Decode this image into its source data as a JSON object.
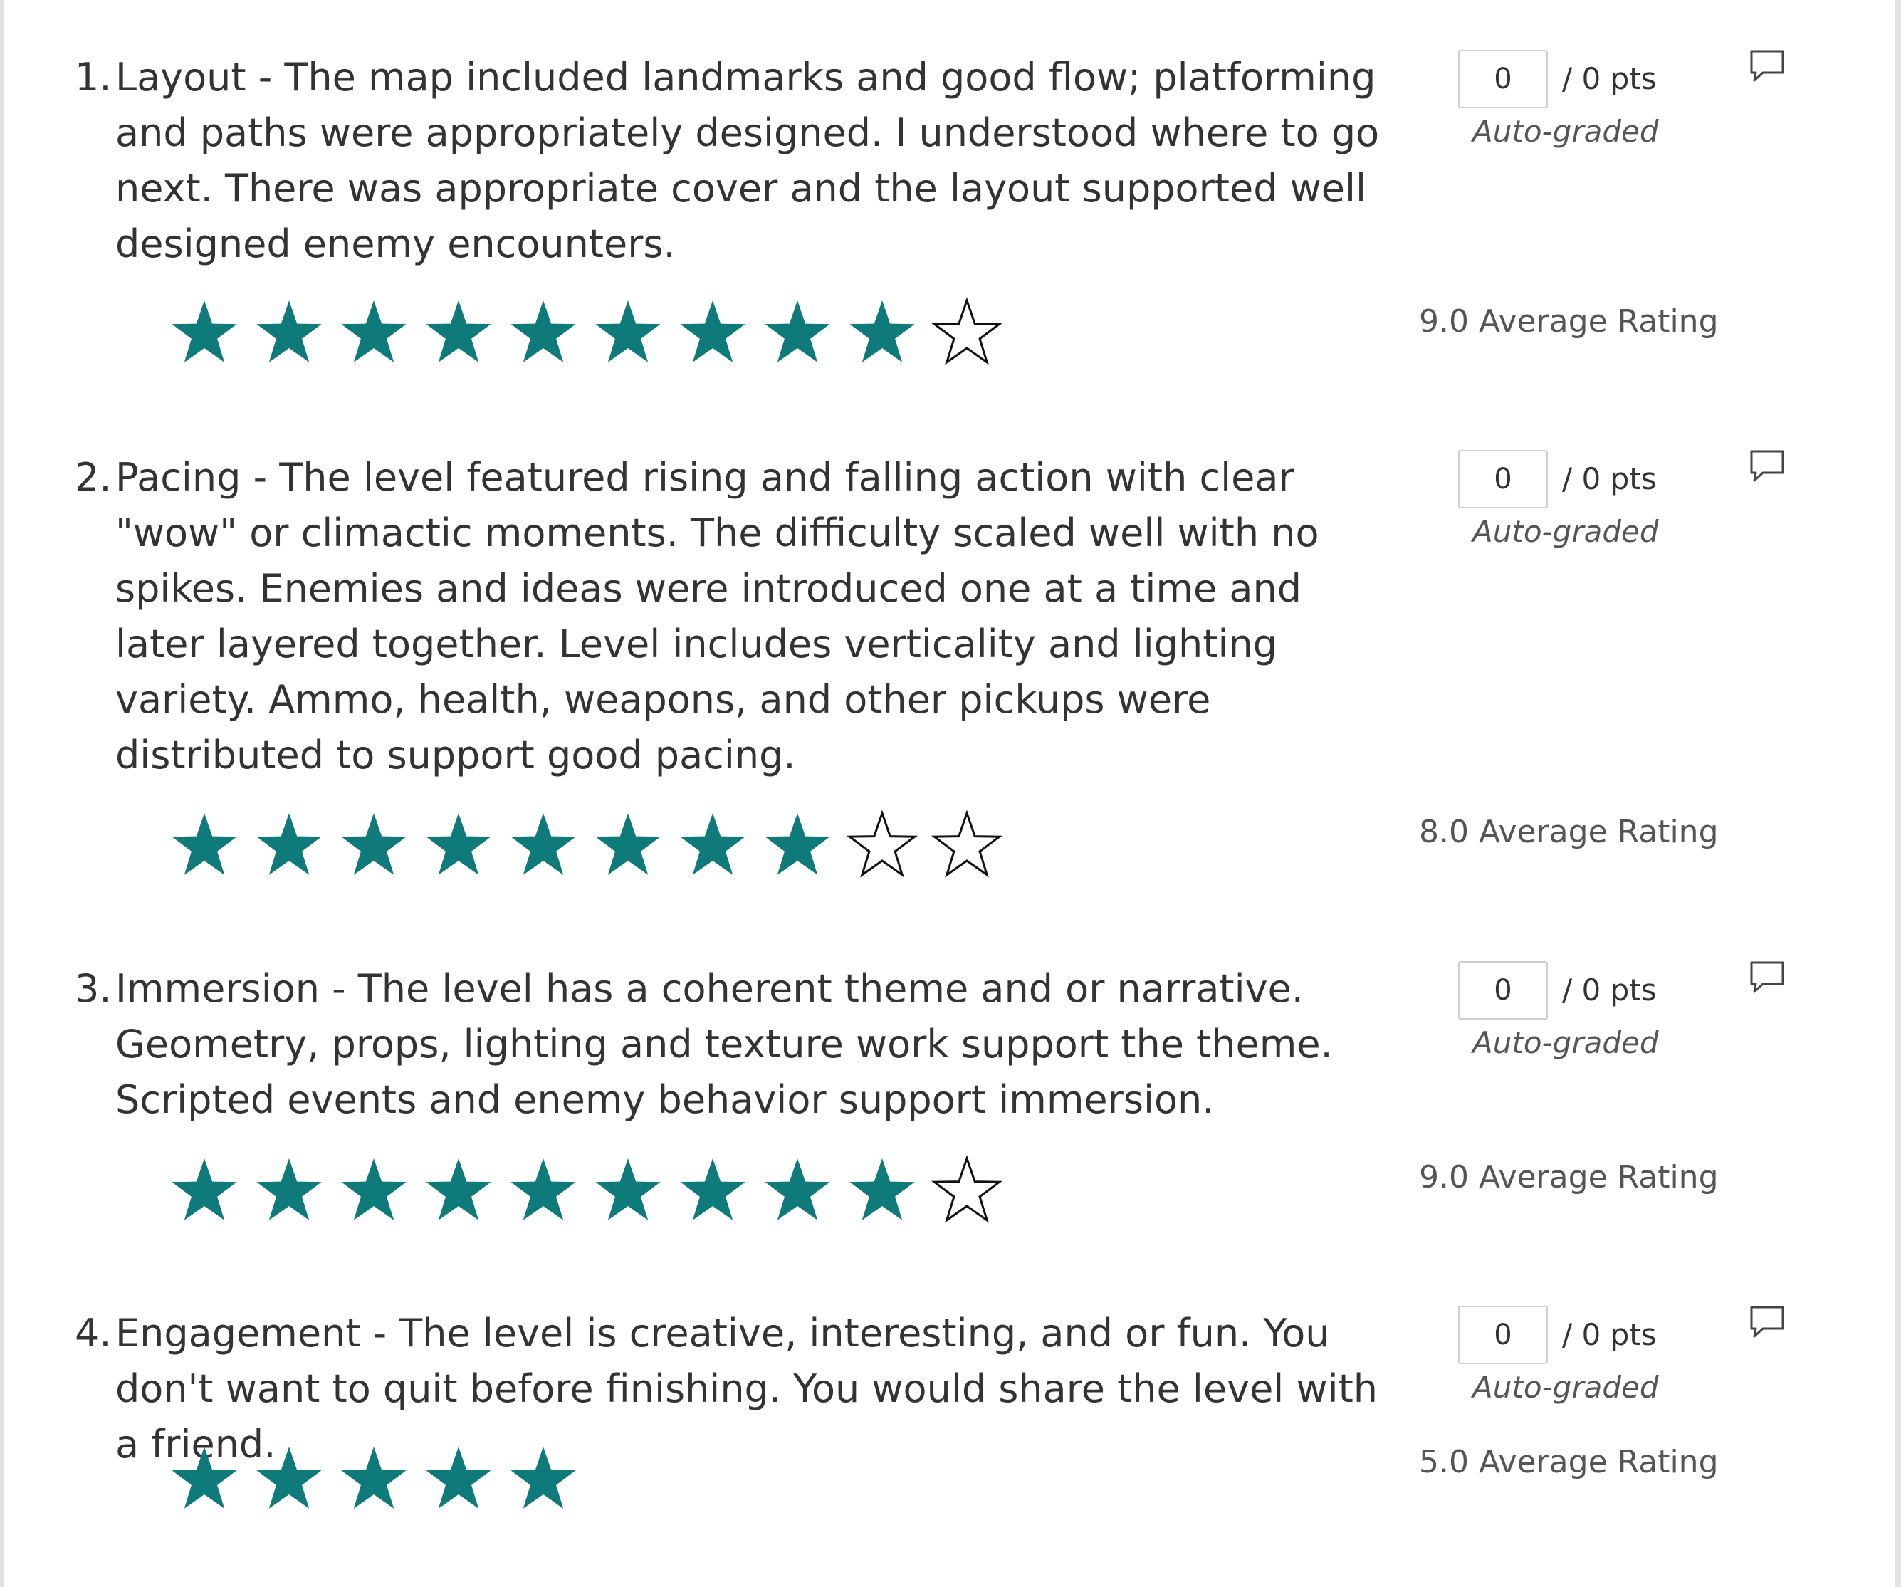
{
  "colors": {
    "star_filled": "#0f7a7a",
    "star_empty_stroke": "#111111",
    "text": "#333333",
    "muted_text": "#555555"
  },
  "questions": [
    {
      "number": "1.",
      "text": "Layout - The map included landmarks and good flow; platforming and paths were appropriately designed. I understood where to go next. There was appropriate cover and the layout supported well designed enemy encounters.",
      "score_value": "0",
      "points_label": "/ 0 pts",
      "grading_label": "Auto-graded",
      "average_rating_label": "9.0 Average Rating",
      "filled_stars": 9,
      "total_stars": 10,
      "comment_icon": "comment-icon"
    },
    {
      "number": "2.",
      "text": "Pacing - The level featured rising and falling action with clear \"wow\" or climactic moments. The difficulty scaled well with no spikes. Enemies and ideas were introduced one at a time and later layered together. Level includes verticality and lighting variety. Ammo, health, weapons, and other pickups were distributed to support good pacing.",
      "score_value": "0",
      "points_label": "/ 0 pts",
      "grading_label": "Auto-graded",
      "average_rating_label": "8.0 Average Rating",
      "filled_stars": 8,
      "total_stars": 10,
      "comment_icon": "comment-icon"
    },
    {
      "number": "3.",
      "text": "Immersion - The level has a coherent theme and or narrative. Geometry, props, lighting and texture work support the theme. Scripted events and enemy behavior support immersion.",
      "score_value": "0",
      "points_label": "/ 0 pts",
      "grading_label": "Auto-graded",
      "average_rating_label": "9.0 Average Rating",
      "filled_stars": 9,
      "total_stars": 10,
      "comment_icon": "comment-icon"
    },
    {
      "number": "4.",
      "text": "Engagement - The level is creative, interesting, and or fun. You don't want to quit before finishing. You would share the level with a friend.",
      "score_value": "0",
      "points_label": "/ 0 pts",
      "grading_label": "Auto-graded",
      "average_rating_label": "5.0 Average Rating",
      "filled_stars": 5,
      "total_stars": 5,
      "comment_icon": "comment-icon"
    }
  ]
}
